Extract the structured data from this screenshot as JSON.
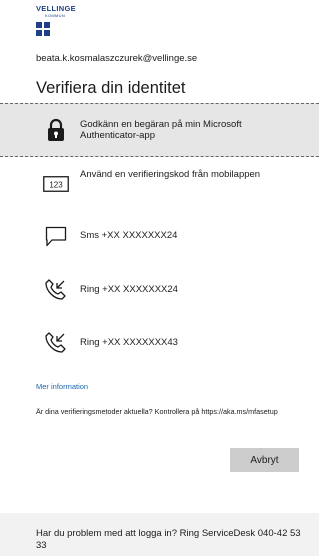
{
  "logo": {
    "word": "VELLINGE",
    "sub": "KOMMUN"
  },
  "account": {
    "email": "beata.k.kosmalaszczurek@vellinge.se"
  },
  "title": "Verifiera din identitet",
  "options": [
    {
      "label": "Godkänn en begäran på min Microsoft Authenticator-app",
      "icon": "lock-icon"
    },
    {
      "label": "Använd en verifieringskod från mobilappen",
      "icon": "code-123-icon",
      "code_text": "123"
    },
    {
      "label": "Sms +XX XXXXXXX24",
      "icon": "chat-bubble-icon"
    },
    {
      "label": "Ring +XX XXXXXXX24",
      "icon": "phone-call-icon"
    },
    {
      "label": "Ring +XX XXXXXXX43",
      "icon": "phone-call-icon"
    }
  ],
  "more_info": "Mer information",
  "notice": "Är dina verifieringsmetoder aktuella? Kontrollera på https://aka.ms/mfasetup",
  "cancel_label": "Avbryt",
  "footer": {
    "text": "Har du problem med att logga in? Ring ServiceDesk 040-42 53 33"
  },
  "colors": {
    "link": "#1f67b0",
    "logo_blue": "#1f3f8a",
    "selected_bg": "#e6e6e6",
    "button_bg": "#cccccc",
    "footer_bg": "#f2f2f2"
  }
}
